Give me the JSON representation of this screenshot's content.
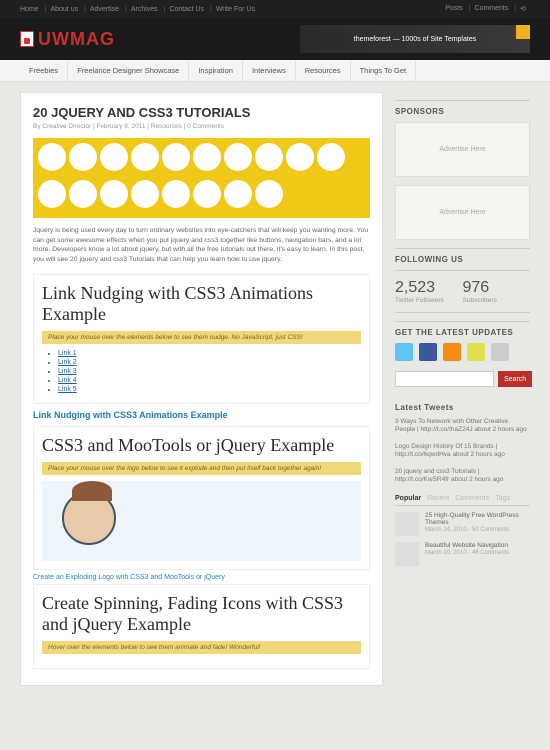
{
  "topbar": {
    "left": [
      "Home",
      "About us",
      "Advertise",
      "Archives",
      "Contact Us",
      "Write For Us"
    ],
    "right": [
      "Posts",
      "Comments"
    ]
  },
  "logo": "UWMAG",
  "banner": "themeforest — 1000s of Site Templates",
  "nav": [
    "Freebies",
    "Freelance Designer Showcase",
    "Inspiration",
    "Interviews",
    "Resources",
    "Things To Get"
  ],
  "post": {
    "title": "20 JQUERY AND CSS3 TUTORIALS",
    "meta": "By Creative Director | February 8, 2011 | Resources | 0 Comments",
    "intro": "Jquery is being used every day to turn ordinary websites into eye-catchers that will keep you wanting more. You can get some awesome effects when you put jquery and css3 together like buttons, navigation bars, and a lot more. Developers know a lot about jquery, but with all the free tutorials out there, it's easy to learn. In this post, you will see 20 jquery and css3 Tutorials that can help you learn how to use jquery."
  },
  "demo1": {
    "heading": "Link Nudging with CSS3 Animations Example",
    "bar": "Place your mouse over the elements below to see them nudge. No JavaScript, just CSS!",
    "links": [
      "Link 1",
      "Link 2",
      "Link 3",
      "Link 4",
      "Link 5"
    ],
    "caption": "Link Nudging with CSS3 Animations Example"
  },
  "demo2": {
    "heading": "CSS3 and MooTools or jQuery Example",
    "bar": "Place your mouse over the logo below to see it explode and then put itself back together again!",
    "caption": "Create an Exploding Logo with CSS3 and MooTools or jQuery"
  },
  "demo3": {
    "heading": "Create Spinning, Fading Icons with CSS3 and jQuery Example",
    "bar": "Hover over the elements below to see them animate and fade! Wonderful!"
  },
  "sidebar": {
    "sponsors_title": "SPONSORS",
    "adtext": "Advertise Here",
    "following_title": "FOLLOWING US",
    "stats": [
      {
        "num": "2,523",
        "lbl": "Twitter Followers"
      },
      {
        "num": "976",
        "lbl": "Subscribers"
      }
    ],
    "updates_title": "GET THE LATEST UPDATES",
    "search_btn": "Search",
    "tweets_title": "Latest Tweets",
    "tweets": [
      "3 Ways To Network with Other Creative People | http://t.co/IhaZ24J about 2 hours ago",
      "Logo Design History Of 15 Brands | http://t.co/6qwdHva about 2 hours ago",
      "20 jquery and css3 Tutorials | http://t.co/KwSR4fr about 2 hours ago"
    ],
    "tabs": [
      "Popular",
      "Recent",
      "Comments",
      "Tags"
    ],
    "popular": [
      {
        "t": "25 High-Quality Free WordPress Themes",
        "m": "March 24, 2010 - 50 Comments"
      },
      {
        "t": "Beautiful Website Navigation",
        "m": "March 20, 2010 - 46 Comments"
      }
    ]
  }
}
